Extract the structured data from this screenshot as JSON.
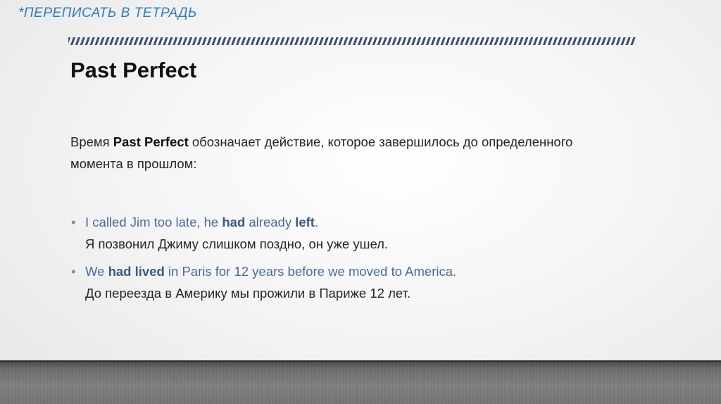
{
  "slide": {
    "note": "*ПЕРЕПИСАТЬ В ТЕТРАДЬ",
    "title": "Past Perfect",
    "intro": {
      "before": "Время ",
      "bold": "Past Perfect",
      "after": " обозначает действие, которое завершилось до определенного момента в прошлом:"
    },
    "examples": [
      {
        "bullet": "•",
        "en": {
          "p1": "I called Jim too late, he ",
          "b1": "had",
          "p2": " already ",
          "b2": "left",
          "p3": "."
        },
        "ru": "Я позвонил Джиму слишком поздно, он уже ушел."
      },
      {
        "bullet": "•",
        "en": {
          "p1": "We ",
          "b1": "had lived",
          "p2": " in Paris for 12 years before we moved to America.",
          "b2": "",
          "p3": ""
        },
        "ru": "До переезда в Америку мы прожили в Париже 12 лет."
      }
    ]
  },
  "colors": {
    "note": "#2e7dba",
    "english_text": "#4a6a9c",
    "russian_text": "#262626",
    "dash_bar": "#3d4f6b"
  }
}
